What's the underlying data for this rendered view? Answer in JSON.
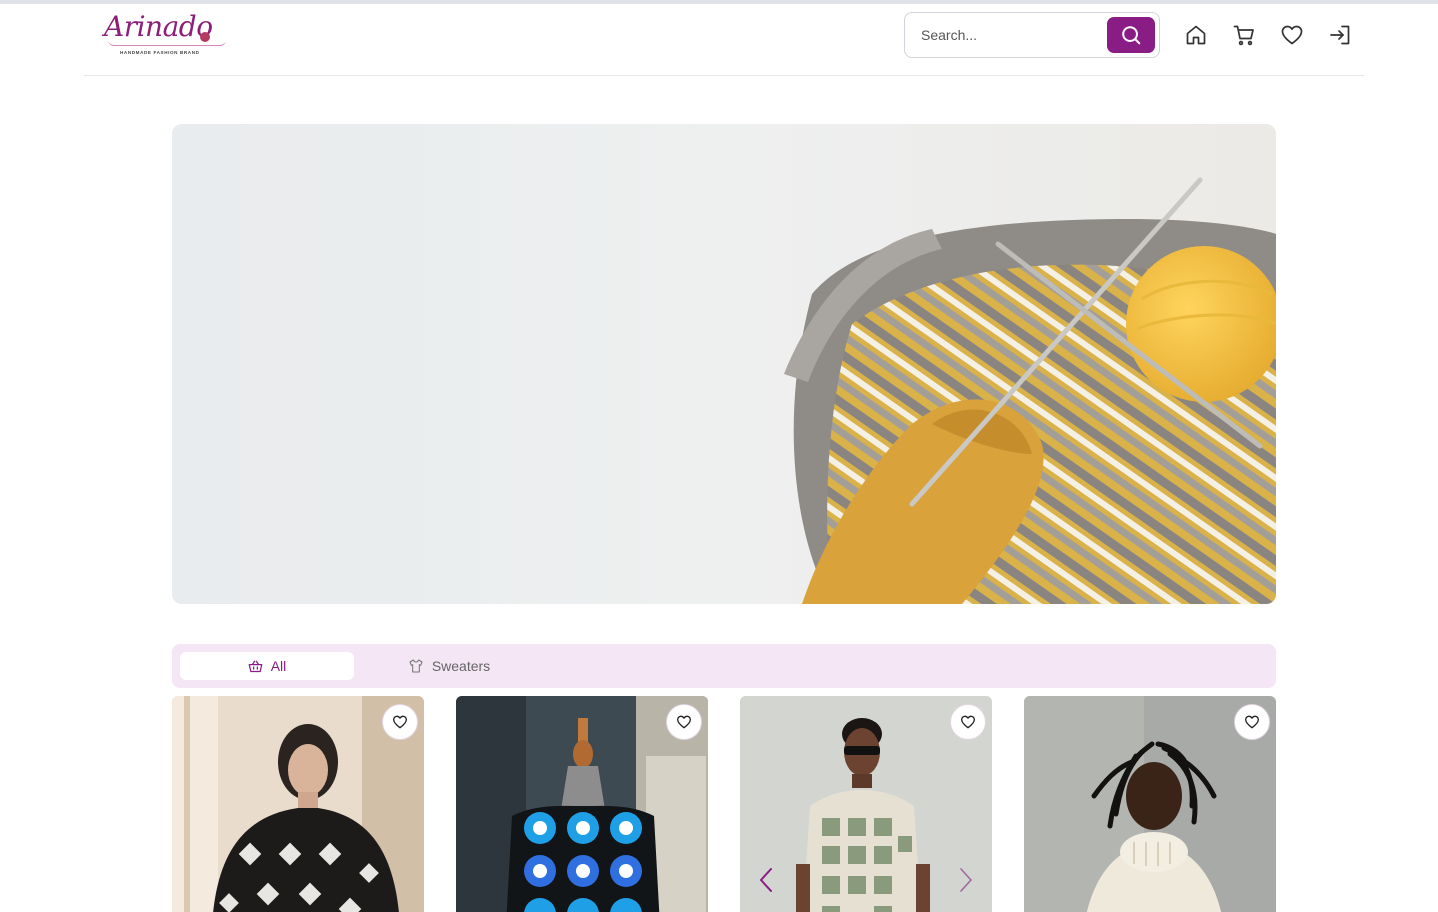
{
  "brand": {
    "logo_text": "Arinado",
    "tagline": "HANDMADE FASHION BRAND",
    "accent_color": "#8a1d85"
  },
  "header": {
    "search_placeholder": "Search...",
    "search_icon": "search-icon",
    "icons": [
      "home-icon",
      "cart-icon",
      "heart-icon",
      "login-icon"
    ]
  },
  "hero": {
    "image": "knitting basket with yellow yarn and needles"
  },
  "tabs": [
    {
      "label": "All",
      "icon": "basket-icon",
      "active": true
    },
    {
      "label": "Sweaters",
      "icon": "shirt-icon",
      "active": false
    }
  ],
  "products": [
    {
      "image": "woman in black crochet granny-square top",
      "favorite_icon": "heart-icon"
    },
    {
      "image": "blue and black granny-square vest on mannequin",
      "favorite_icon": "heart-icon"
    },
    {
      "image": "man in beige crochet shirt with sunglasses",
      "favorite_icon": "heart-icon",
      "carousel": [
        "chevron-left-icon",
        "chevron-right-icon"
      ]
    },
    {
      "image": "man with dreadlocks in cream knit turtleneck",
      "favorite_icon": "heart-icon"
    }
  ]
}
